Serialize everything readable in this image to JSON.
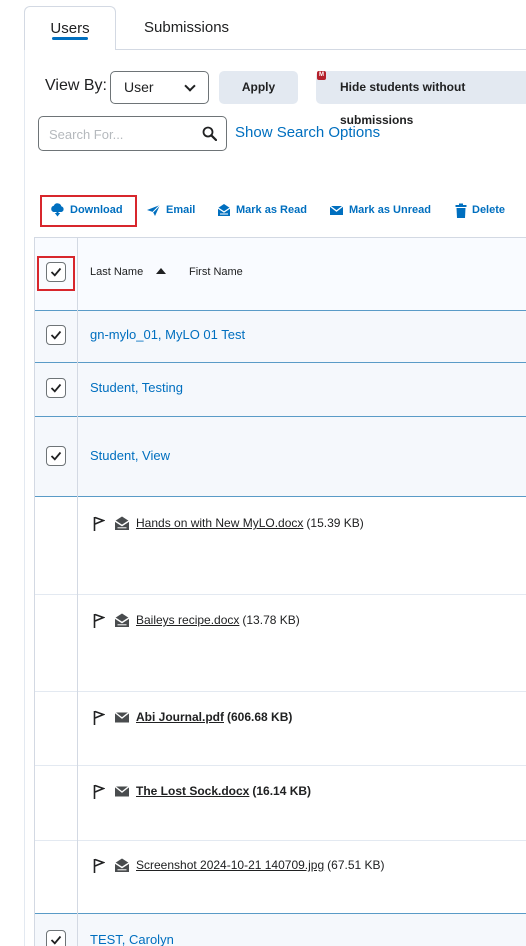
{
  "tabs": [
    {
      "label": "Users",
      "active": true
    },
    {
      "label": "Submissions",
      "active": false
    }
  ],
  "view_by": {
    "label": "View By:",
    "selected": "User",
    "apply_label": "Apply",
    "hide_label": "Hide students without submissions",
    "hide_badge": "M"
  },
  "search": {
    "placeholder": "Search For...",
    "options_label": "Show Search Options"
  },
  "toolbar": {
    "download": "Download",
    "email": "Email",
    "mark_read": "Mark as Read",
    "mark_unread": "Mark as Unread",
    "delete": "Delete"
  },
  "table": {
    "headers": {
      "last_name": "Last Name",
      "first_name": "First Name"
    },
    "users": [
      {
        "name": "gn-mylo_01, MyLO 01 Test",
        "checked": true
      },
      {
        "name": "Student, Testing",
        "checked": true
      },
      {
        "name": "Student, View",
        "checked": true
      },
      {
        "name": "TEST, Carolyn",
        "checked": true
      }
    ],
    "files": [
      {
        "name": "Hands on with New MyLO.docx",
        "size": "(15.39 KB)",
        "read": true
      },
      {
        "name": "Baileys recipe.docx",
        "size": "(13.78 KB)",
        "read": true
      },
      {
        "name": "Abi Journal.pdf",
        "size": "(606.68 KB)",
        "read": false
      },
      {
        "name": "The Lost Sock.docx",
        "size": "(16.14 KB)",
        "read": false
      },
      {
        "name": "Screenshot 2024-10-21 140709.jpg",
        "size": "(67.51 KB)",
        "read": true
      }
    ]
  },
  "colors": {
    "link_blue": "#006fbf",
    "highlight_red": "#d8262c",
    "button_gray": "#e3e9f1"
  }
}
